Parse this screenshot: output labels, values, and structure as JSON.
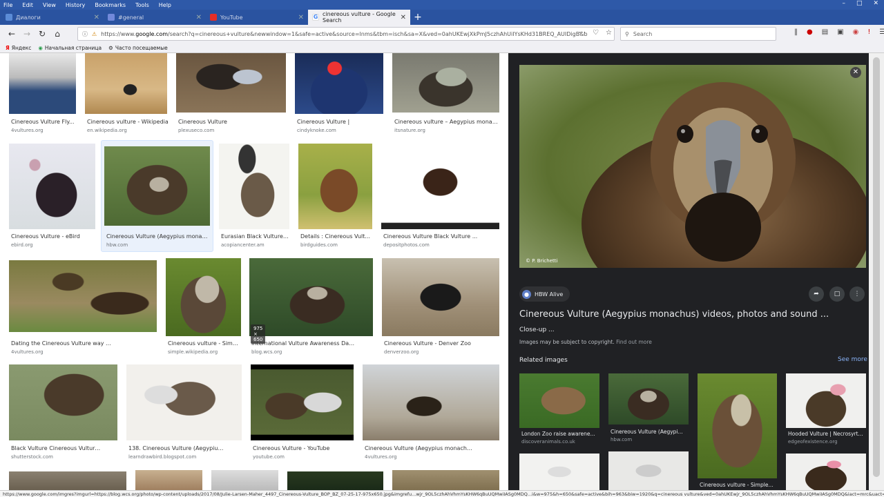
{
  "browser": {
    "menu": [
      "File",
      "Edit",
      "View",
      "History",
      "Bookmarks",
      "Tools",
      "Help"
    ],
    "tabs": [
      {
        "title": "Диалоги",
        "active": false
      },
      {
        "title": "#general",
        "active": false
      },
      {
        "title": "YouTube",
        "active": false
      },
      {
        "title": "cinereous vulture - Google Search",
        "active": true
      }
    ],
    "url_prefix": "https://www.",
    "url_domain": "google.com",
    "url_rest": "/search?q=cinereous+vulture&newwindow=1&safe=active&source=lnms&tbm=isch&sa=X&ved=0ahUKEwjXkPmJ5czhAhUiIYsKHd31BREQ_AUIDigB&b",
    "search_placeholder": "Search",
    "bookmarks": [
      "Яндекс",
      "Начальная страница",
      "Часто посещаемые"
    ],
    "status_url": "https://www.google.com/imgres?imgurl=https://blog.wcs.org/photo/wp-content/uploads/2017/08/Julie-Larsen-Maher_4497_Cinereous-Vulture_BOP_BZ_07-25-17-975x650.jpg&imgrefu...wjr_9OL5czhAhVhmYsKHW6qBuUQMwiIASg0MDQ...i&w=975&h=650&safe=active&bih=963&biw=1920&q=cinereous vulture&ved=0ahUKEwjr_9OL5czhAhVhmYsKHW6qBuUQMwiIASg0MDQ&iact=mrc&uact=8"
  },
  "results": [
    {
      "caption": "Cinereous Vulture Fly...",
      "source": "4vultures.org"
    },
    {
      "caption": "Cinereous vulture - Wikipedia",
      "source": "en.wikipedia.org"
    },
    {
      "caption": "Cinereous Vulture",
      "source": "plexuseco.com"
    },
    {
      "caption": "Cinereous Vulture |",
      "source": "cindyknoke.com"
    },
    {
      "caption": "Cinereous vulture – Aegypius monac...",
      "source": "itsnature.org"
    },
    {
      "caption": "Cinereous Vulture - eBird",
      "source": "ebird.org"
    },
    {
      "caption": "Cinereous Vulture (Aegypius monac...",
      "source": "hbw.com"
    },
    {
      "caption": "Eurasian Black Vulture,...",
      "source": "acopiancenter.am"
    },
    {
      "caption": "Details : Cinereous Vult...",
      "source": "birdguides.com"
    },
    {
      "caption": "Cinereous Vulture Black Vulture ...",
      "source": "depositphotos.com"
    },
    {
      "caption": "Dating the Cinereous Vulture way ...",
      "source": "4vultures.org"
    },
    {
      "caption": "Cinereous vulture - Simp...",
      "source": "simple.wikipedia.org"
    },
    {
      "caption": "International Vulture Awareness Day...",
      "source": "blog.wcs.org"
    },
    {
      "caption": "Cinereous Vulture - Denver Zoo",
      "source": "denverzoo.org"
    },
    {
      "caption": "Black Vulture Cinereous Vulture ...",
      "source": "shutterstock.com"
    },
    {
      "caption": "138. Cinereous Vulture (Aegypius ...",
      "source": "learndrawbird.blogspot.com"
    },
    {
      "caption": "Cinereous Vulture - YouTube",
      "source": "youtube.com"
    },
    {
      "caption": "Cinereous Vulture (Aegypius monachus ...",
      "source": "4vultures.org"
    }
  ],
  "hover_dims": "975 × 650",
  "panel": {
    "credit": "© P. Brichetti",
    "source_chip": "HBW Alive",
    "title": "Cinereous Vulture (Aegypius monachus) videos, photos and sound ...",
    "subtitle": "Close-up ...",
    "note": "Images may be subject to copyright.",
    "note_link": "Find out more",
    "related_label": "Related images",
    "see_more": "See more",
    "related": [
      {
        "caption": "London Zoo raise awarene...",
        "source": "discoveranimals.co.uk"
      },
      {
        "caption": "Cinereous Vulture (Aegypi...",
        "source": "hbw.com"
      },
      {
        "caption": "Cinereous vulture - Simple...",
        "source": ""
      },
      {
        "caption": "Hooded Vulture | Necrosyrt...",
        "source": "edgeofexistence.org"
      }
    ]
  }
}
